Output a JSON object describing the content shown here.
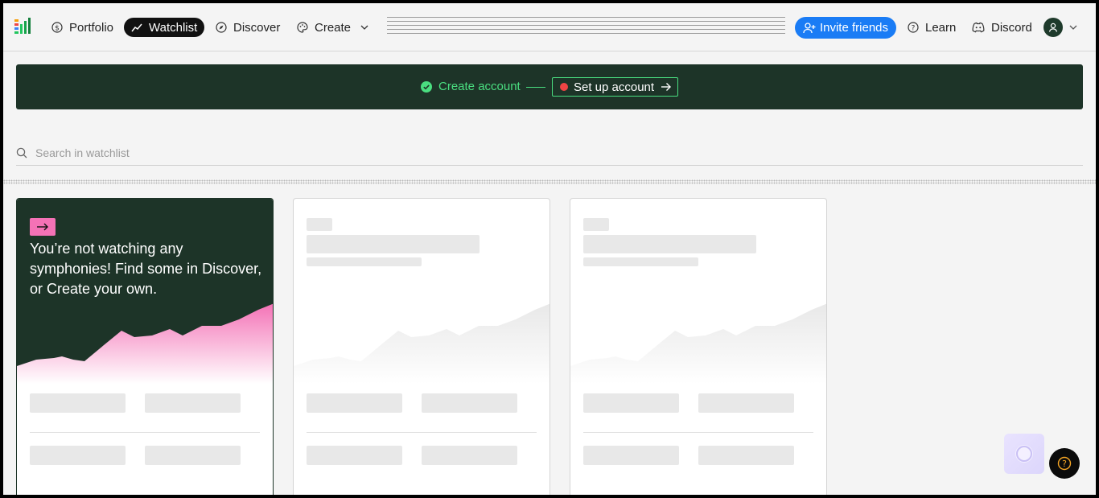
{
  "nav": {
    "portfolio": "Portfolio",
    "watchlist": "Watchlist",
    "discover": "Discover",
    "create": "Create",
    "invite": "Invite friends",
    "learn": "Learn",
    "discord": "Discord"
  },
  "banner": {
    "step_done": "Create account",
    "step_current": "Set up account"
  },
  "search": {
    "placeholder": "Search in watchlist"
  },
  "promo": {
    "text": "You’re not watching any symphonies! Find some in Discover, or Create your own."
  },
  "colors": {
    "brand_dark": "#1d3428",
    "accent_green": "#4ade80",
    "accent_pink": "#f472b6",
    "invite_blue": "#1a7cf5",
    "status_red": "#ef4444"
  },
  "icons": [
    "logo-icon",
    "dollar-icon",
    "trend-icon",
    "compass-icon",
    "palette-icon",
    "chevron-down-icon",
    "user-plus-icon",
    "question-icon",
    "discord-icon",
    "check-circle-icon",
    "arrow-right-icon",
    "search-icon",
    "help-icon"
  ]
}
